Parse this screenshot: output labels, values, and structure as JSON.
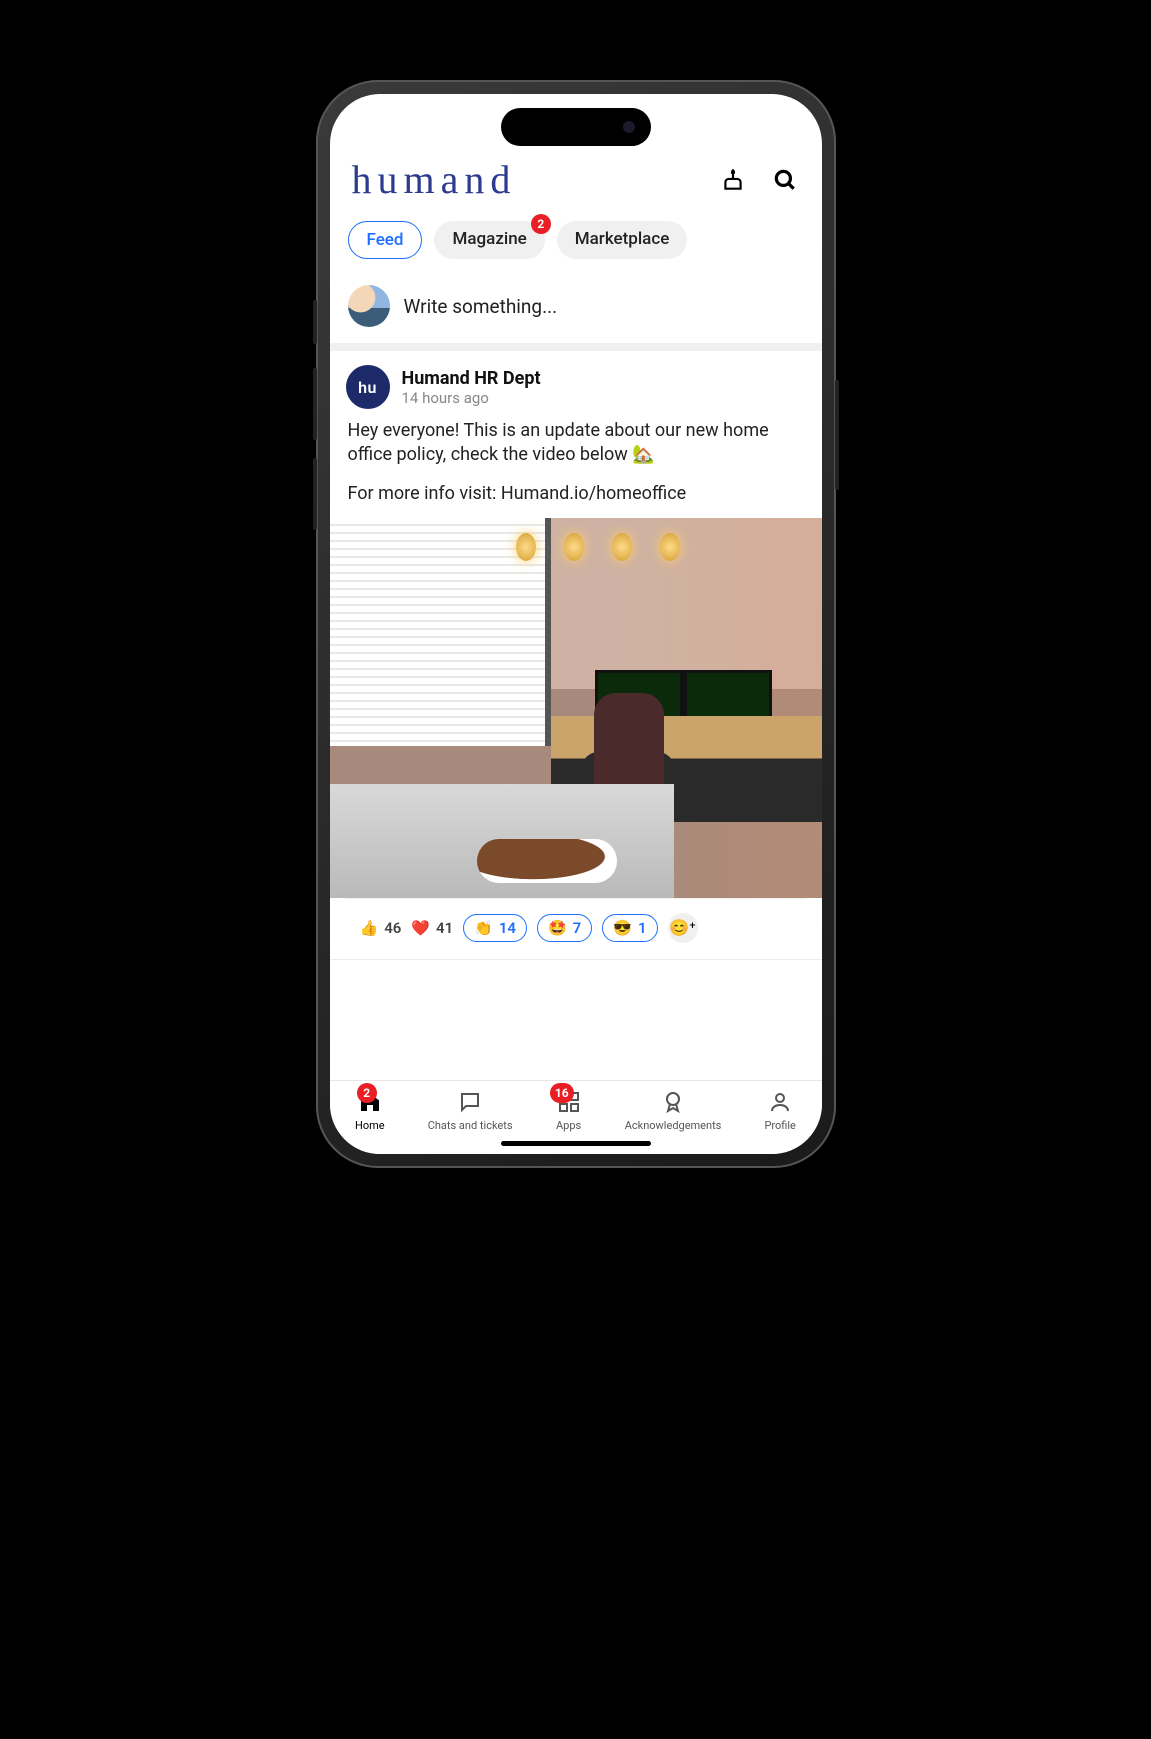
{
  "brand": "humand",
  "tabs": [
    {
      "label": "Feed",
      "active": true
    },
    {
      "label": "Magazine",
      "badge": "2"
    },
    {
      "label": "Marketplace"
    }
  ],
  "composer": {
    "placeholder": "Write something..."
  },
  "post": {
    "author": "Humand HR Dept",
    "author_initials": "hu",
    "time": "14 hours ago",
    "line1": "Hey everyone! This is an update about our new home office policy, check the video below 🏡",
    "line2": "For more info visit: Humand.io/homeoffice"
  },
  "reactions": {
    "thumbs": {
      "emoji": "👍",
      "count": "46"
    },
    "heart": {
      "emoji": "❤️",
      "count": "41"
    },
    "clap": {
      "emoji": "👏",
      "count": "14"
    },
    "star": {
      "emoji": "🤩",
      "count": "7"
    },
    "cool": {
      "emoji": "😎",
      "count": "1"
    },
    "add": {
      "emoji": "😊⁺"
    }
  },
  "nav": {
    "home": {
      "label": "Home",
      "badge": "2"
    },
    "chats": {
      "label": "Chats and tickets"
    },
    "apps": {
      "label": "Apps",
      "badge": "16"
    },
    "ack": {
      "label": "Acknowledgements"
    },
    "profile": {
      "label": "Profile"
    }
  }
}
